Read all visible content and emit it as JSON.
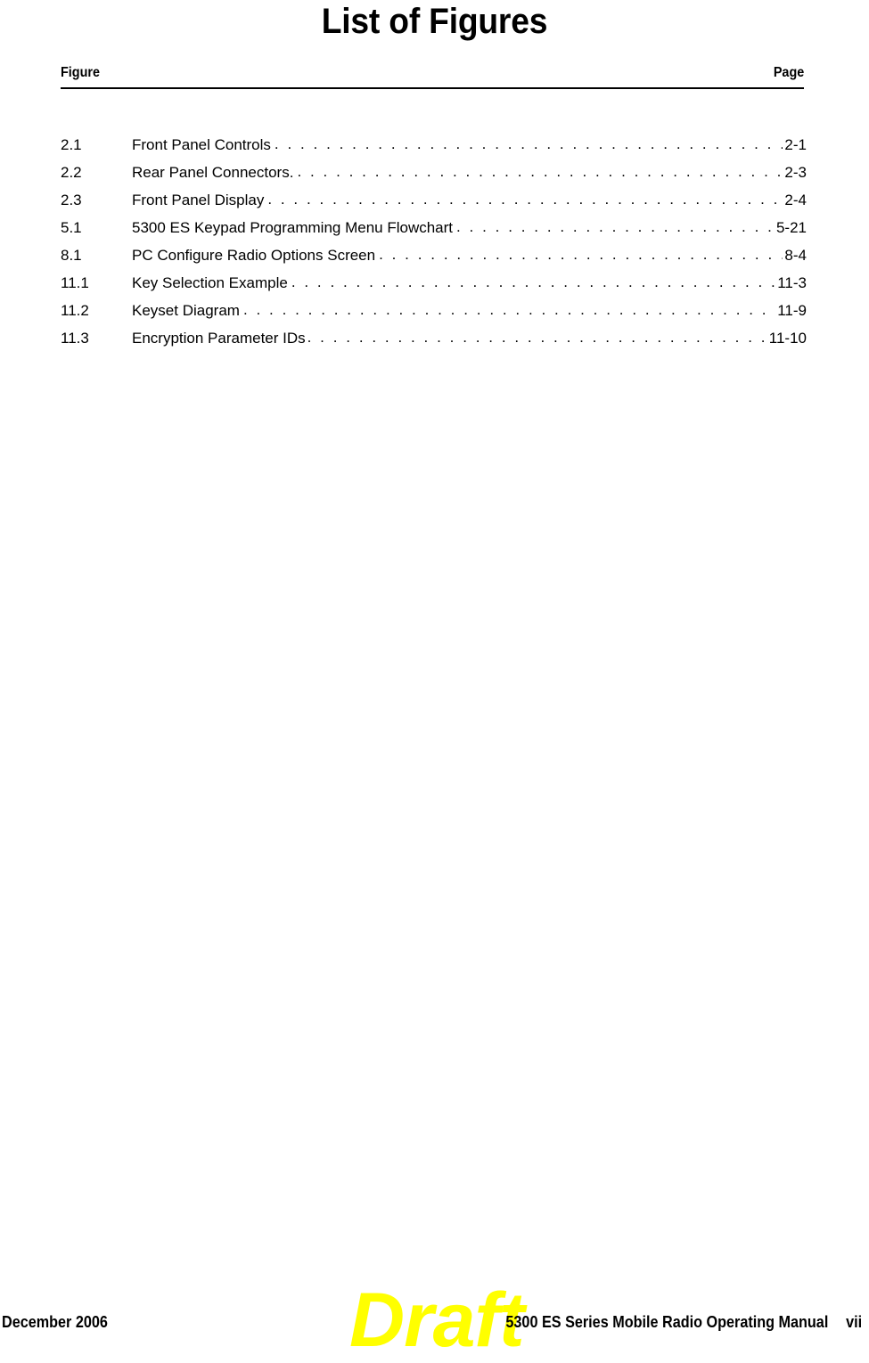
{
  "document": {
    "title": "List of Figures"
  },
  "table_header": {
    "figure_label": "Figure",
    "page_label": "Page"
  },
  "figures": [
    {
      "number": "2.1",
      "title": "Front Panel Controls",
      "dots": ". . . . . . . . . . . . . . . . . . . . . . . . . . . . . . . . . . . . . . . . . . . . . . . . . .",
      "page": "2-1"
    },
    {
      "number": "2.2",
      "title": "Rear Panel Connectors.",
      "dots": ". . . . . . . . . . . . . . . . . . . . . . . . . . . . . . . . . . . . . . . . . . . . . . . . . .",
      "page": "2-3"
    },
    {
      "number": "2.3",
      "title": "Front Panel Display",
      "dots": ". . . . . . . . . . . . . . . . . . . . . . . . . . . . . . . . . . . . . . . . . . . . . . . . . .",
      "page": "2-4"
    },
    {
      "number": "5.1",
      "title": "5300 ES Keypad Programming Menu Flowchart",
      "dots": ". . . . . . . . . . . . . . . . . . . . . . . . . . . . . . . . . . . . . . . . . . . . . . . . . .",
      "page": "5-21"
    },
    {
      "number": "8.1",
      "title": "PC Configure Radio Options Screen",
      "dots": ". . . . . . . . . . . . . . . . . . . . . . . . . . . . . . . . . . . . . . . . . . . . . . . . . .",
      "page": "8-4"
    },
    {
      "number": "11.1",
      "title": "Key Selection Example",
      "dots": ". . . . . . . . . . . . . . . . . . . . . . . . . . . . . . . . . . . . . . . . . . . . . . . . . .",
      "page": "11-3"
    },
    {
      "number": "11.2",
      "title": "Keyset Diagram",
      "dots": ". . . . . . . . . . . . . . . . . . . . . . . . . . . . . . . . . . . . . . . . . . . . . . . . . .",
      "page": "11-9"
    },
    {
      "number": "11.3",
      "title": "Encryption Parameter IDs",
      "dots": ". . . . . . . . . . . . . . . . . . . . . . . . . . . . . . . . . . . . . . . . . . . . . . . . . .",
      "page": "11-10"
    }
  ],
  "footer": {
    "date": "December 2006",
    "manual_title": "5300 ES Series Mobile Radio Operating Manual",
    "page_number": "vii",
    "watermark": "Draft",
    "watermark_color": "#ffff00"
  }
}
